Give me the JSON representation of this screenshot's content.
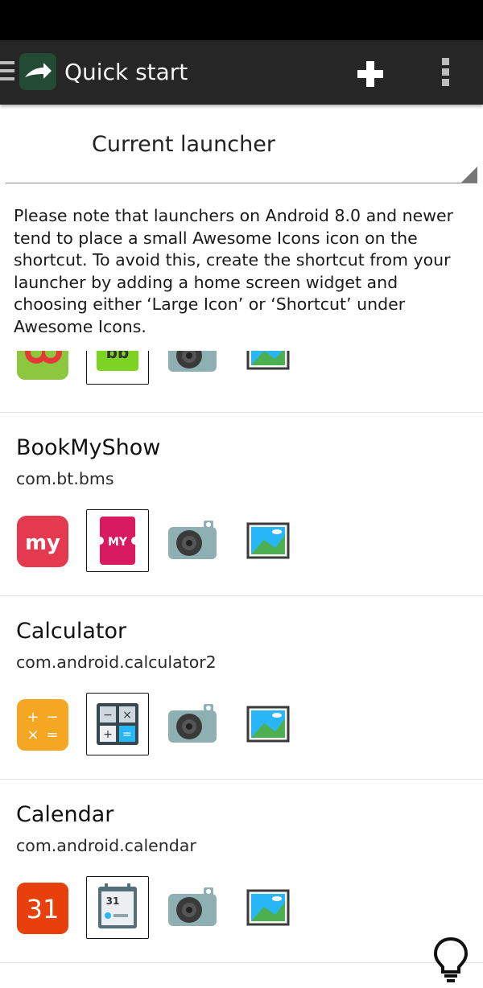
{
  "app_bar": {
    "title": "Quick start"
  },
  "launcher_spinner": {
    "selected": "Current launcher"
  },
  "note": "Please note that launchers on Android 8.0 and newer tend to place a small Awesome Icons icon on the shortcut. To avoid this, create the shortcut from your launcher by adding a home screen widget and choosing either ‘Large Icon’ or ‘Shortcut’ under Awesome Icons.",
  "apps": [
    {
      "name": "BookMyShow",
      "package": "com.bt.bms"
    },
    {
      "name": "Calculator",
      "package": "com.android.calculator2"
    },
    {
      "name": "Calendar",
      "package": "com.android.calendar"
    }
  ],
  "calendar_day": "31",
  "colors": {
    "app_bar": "#262626",
    "status_bar": "#000000",
    "divider": "#e0e0e0"
  }
}
